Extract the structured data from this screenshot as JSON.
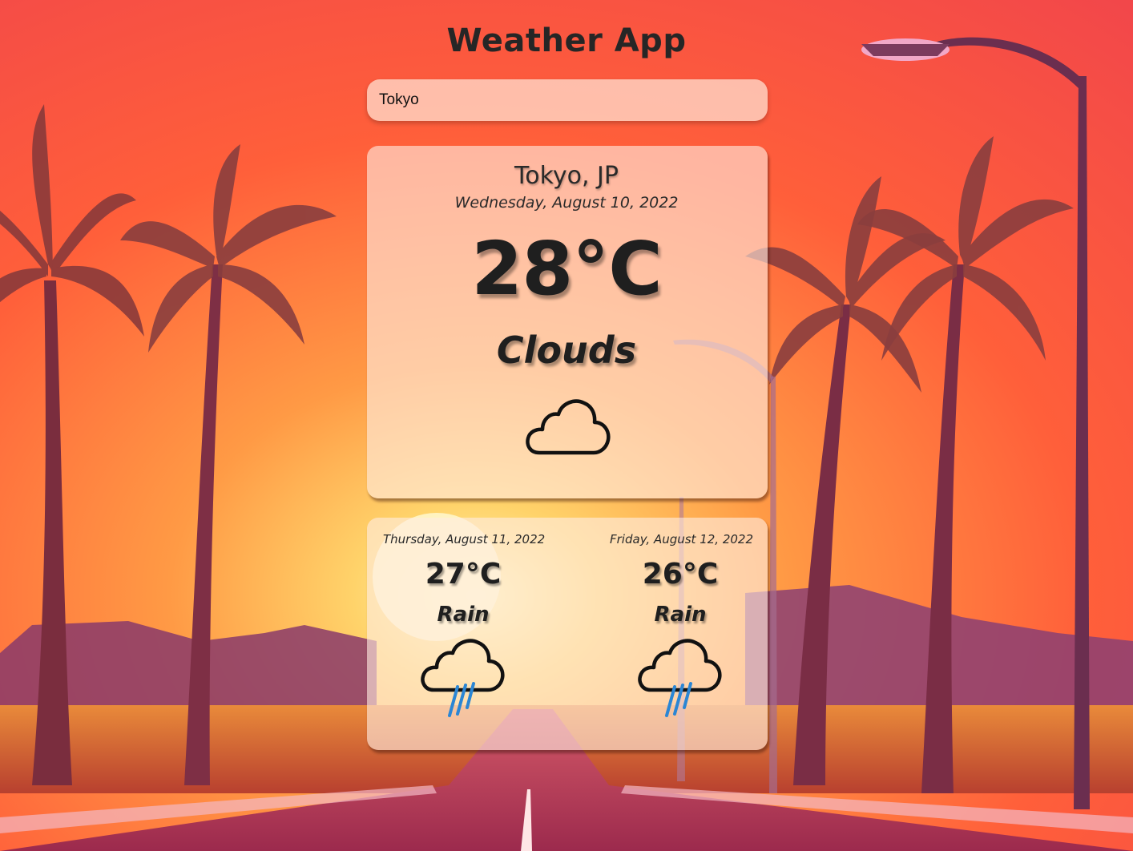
{
  "app": {
    "title": "Weather App"
  },
  "search": {
    "value": "Tokyo",
    "placeholder": ""
  },
  "current": {
    "location": "Tokyo, JP",
    "date": "Wednesday, August 10, 2022",
    "temperature": "28°C",
    "condition": "Clouds",
    "icon": "cloud-icon"
  },
  "forecast": [
    {
      "date": "Thursday, August 11, 2022",
      "temperature": "27°C",
      "condition": "Rain",
      "icon": "rain-cloud-icon"
    },
    {
      "date": "Friday, August 12, 2022",
      "temperature": "26°C",
      "condition": "Rain",
      "icon": "rain-cloud-icon"
    }
  ],
  "colors": {
    "sky_top": "#ff5a3c",
    "sun_glow": "#ffe9a0",
    "text": "#1f1f1f",
    "card_bg": "#ffece1",
    "rain_drop": "#2b86d4"
  }
}
